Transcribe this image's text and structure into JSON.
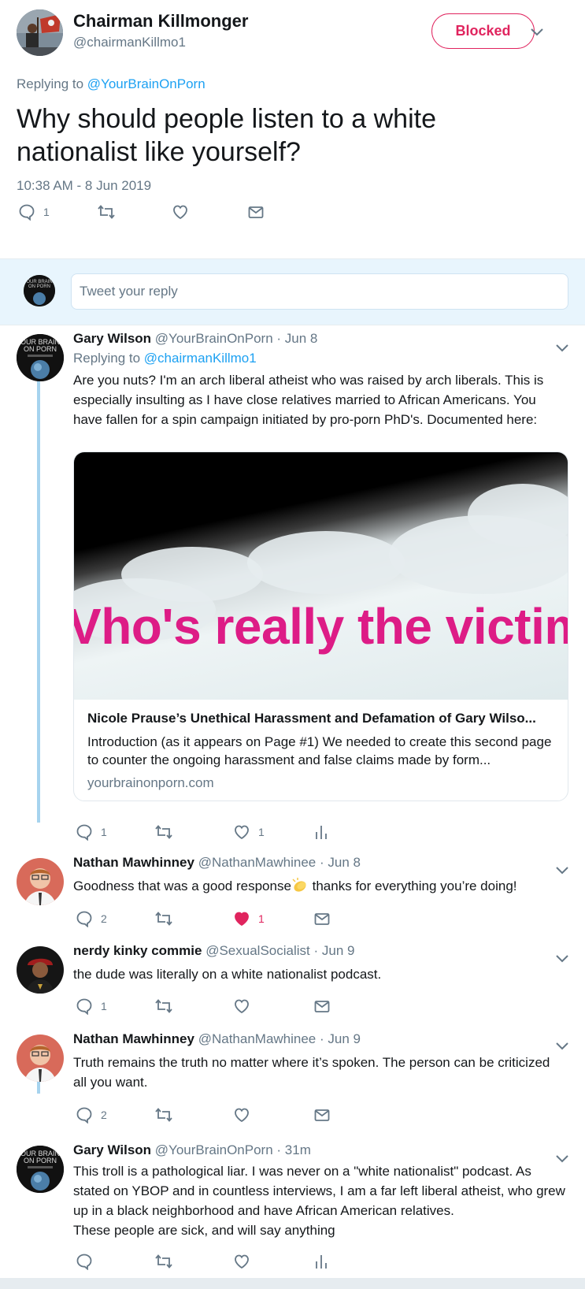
{
  "main_tweet": {
    "name": "Chairman Killmonger",
    "handle": "@chairmanKillmo1",
    "blocked_label": "Blocked",
    "replying_prefix": "Replying to",
    "replying_to": "@YourBrainOnPorn",
    "text": "Why should people listen to a white nationalist like yourself?",
    "timestamp": "10:38 AM - 8 Jun 2019",
    "reply_count": "1"
  },
  "reply_box": {
    "placeholder": "Tweet your reply"
  },
  "replies": [
    {
      "name": "Gary Wilson",
      "handle": "@YourBrainOnPorn",
      "time": "· Jun 8",
      "replying_prefix": "Replying to",
      "replying_to": "@chairmanKillmo1",
      "text": "Are you nuts? I'm an arch liberal atheist who was raised by arch liberals. This is especially insulting as I have close relatives married to African Americans. You have fallen for a spin campaign initiated by pro-porn PhD's. Documented here:",
      "card": {
        "image_text": "Vho's really the victim'",
        "title": "Nicole Prause’s Unethical Harassment and Defamation of Gary Wilso...",
        "description": "Introduction (as it appears on Page #1) We needed to create this second page to counter the ongoing harassment and false claims made by form...",
        "domain": "yourbrainonporn.com"
      },
      "reply_count": "1",
      "like_count": "1"
    },
    {
      "name": "Nathan Mawhinney",
      "handle": "@NathanMawhinee",
      "time": "· Jun 8",
      "text_before_emoji": "Goodness that was a good response",
      "text_after_emoji": " thanks for everything you’re doing!",
      "emoji": "clapping-hands",
      "reply_count": "2",
      "like_count": "1"
    },
    {
      "name": "nerdy kinky commie",
      "handle": "@SexualSocialist",
      "time": "· Jun 9",
      "text": "the dude was literally on a white nationalist podcast.",
      "reply_count": "1"
    },
    {
      "name": "Nathan Mawhinney",
      "handle": "@NathanMawhinee",
      "time": "· Jun 9",
      "text": "Truth remains the truth no matter where it’s spoken. The person can be criticized all you want.",
      "reply_count": "2"
    },
    {
      "name": "Gary Wilson",
      "handle": "@YourBrainOnPorn",
      "time": "· 31m",
      "text": "This troll is a pathological liar. I was never on a \"white nationalist\" podcast. As stated on YBOP and in countless interviews, I am a far left liberal atheist, who grew up in a black neighborhood and have African American relatives.",
      "text_2": "These people are sick, and will say anything"
    }
  ],
  "colors": {
    "accent": "#1da1f2",
    "blocked": "#e0245e",
    "like_active": "#e0245e",
    "muted": "#657786",
    "thread_line": "#a6d3ee",
    "reply_bg": "#e8f5fd",
    "card_headline": "#dd1c86"
  },
  "avatar_text": {
    "ybop_line1": "OUR BRAIN",
    "ybop_line2": "ON PORN"
  }
}
